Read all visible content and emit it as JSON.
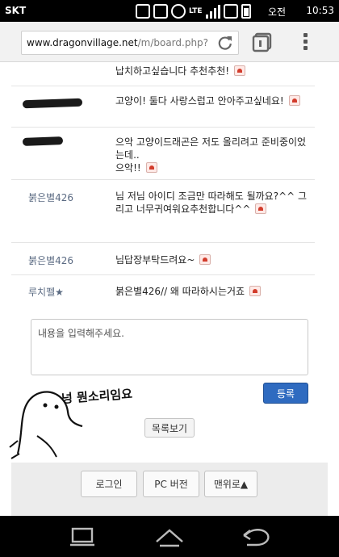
{
  "status_bar": {
    "carrier": "SKT",
    "network": "LTE",
    "ampm": "오전",
    "time": "10:53"
  },
  "browser": {
    "url_host": "www.dragonvillage.net",
    "url_path": "/m/board.php?b"
  },
  "comments": [
    {
      "author": "",
      "text": "납치하고싶습니다 추천추천!",
      "has_emoticon": true
    },
    {
      "author": "",
      "text": "고양이! 둘다 사랑스럽고 안아주고싶네요!",
      "has_emoticon": true
    },
    {
      "author": "",
      "text": "으악 고양이드래곤은 저도 올리려고 준비중이었는데..\n으악!!",
      "has_emoticon": true
    },
    {
      "author": "붉은별426",
      "text": "님 저님 아이디 조금만 따라해도 될까요?^^ 그리고 너무귀여워요추천합니다^^",
      "has_emoticon": true
    },
    {
      "author": "붉은별426",
      "text": "님답장부탁드려요~",
      "has_emoticon": true
    },
    {
      "author": "루치펠★",
      "text": "붉은별426// 왜 따라하시는거죠",
      "has_emoticon": true
    }
  ],
  "comment_form": {
    "placeholder": "내용을 입력해주세요.",
    "submit_label": "등록"
  },
  "doodle_text": "넝 뭔소리임요",
  "list_button_label": "목록보기",
  "footer": {
    "login_label": "로그인",
    "pc_version_label": "PC 버전",
    "top_label": "맨위로▲"
  },
  "colors": {
    "accent": "#2f6bc0",
    "author": "#5a6a82"
  }
}
